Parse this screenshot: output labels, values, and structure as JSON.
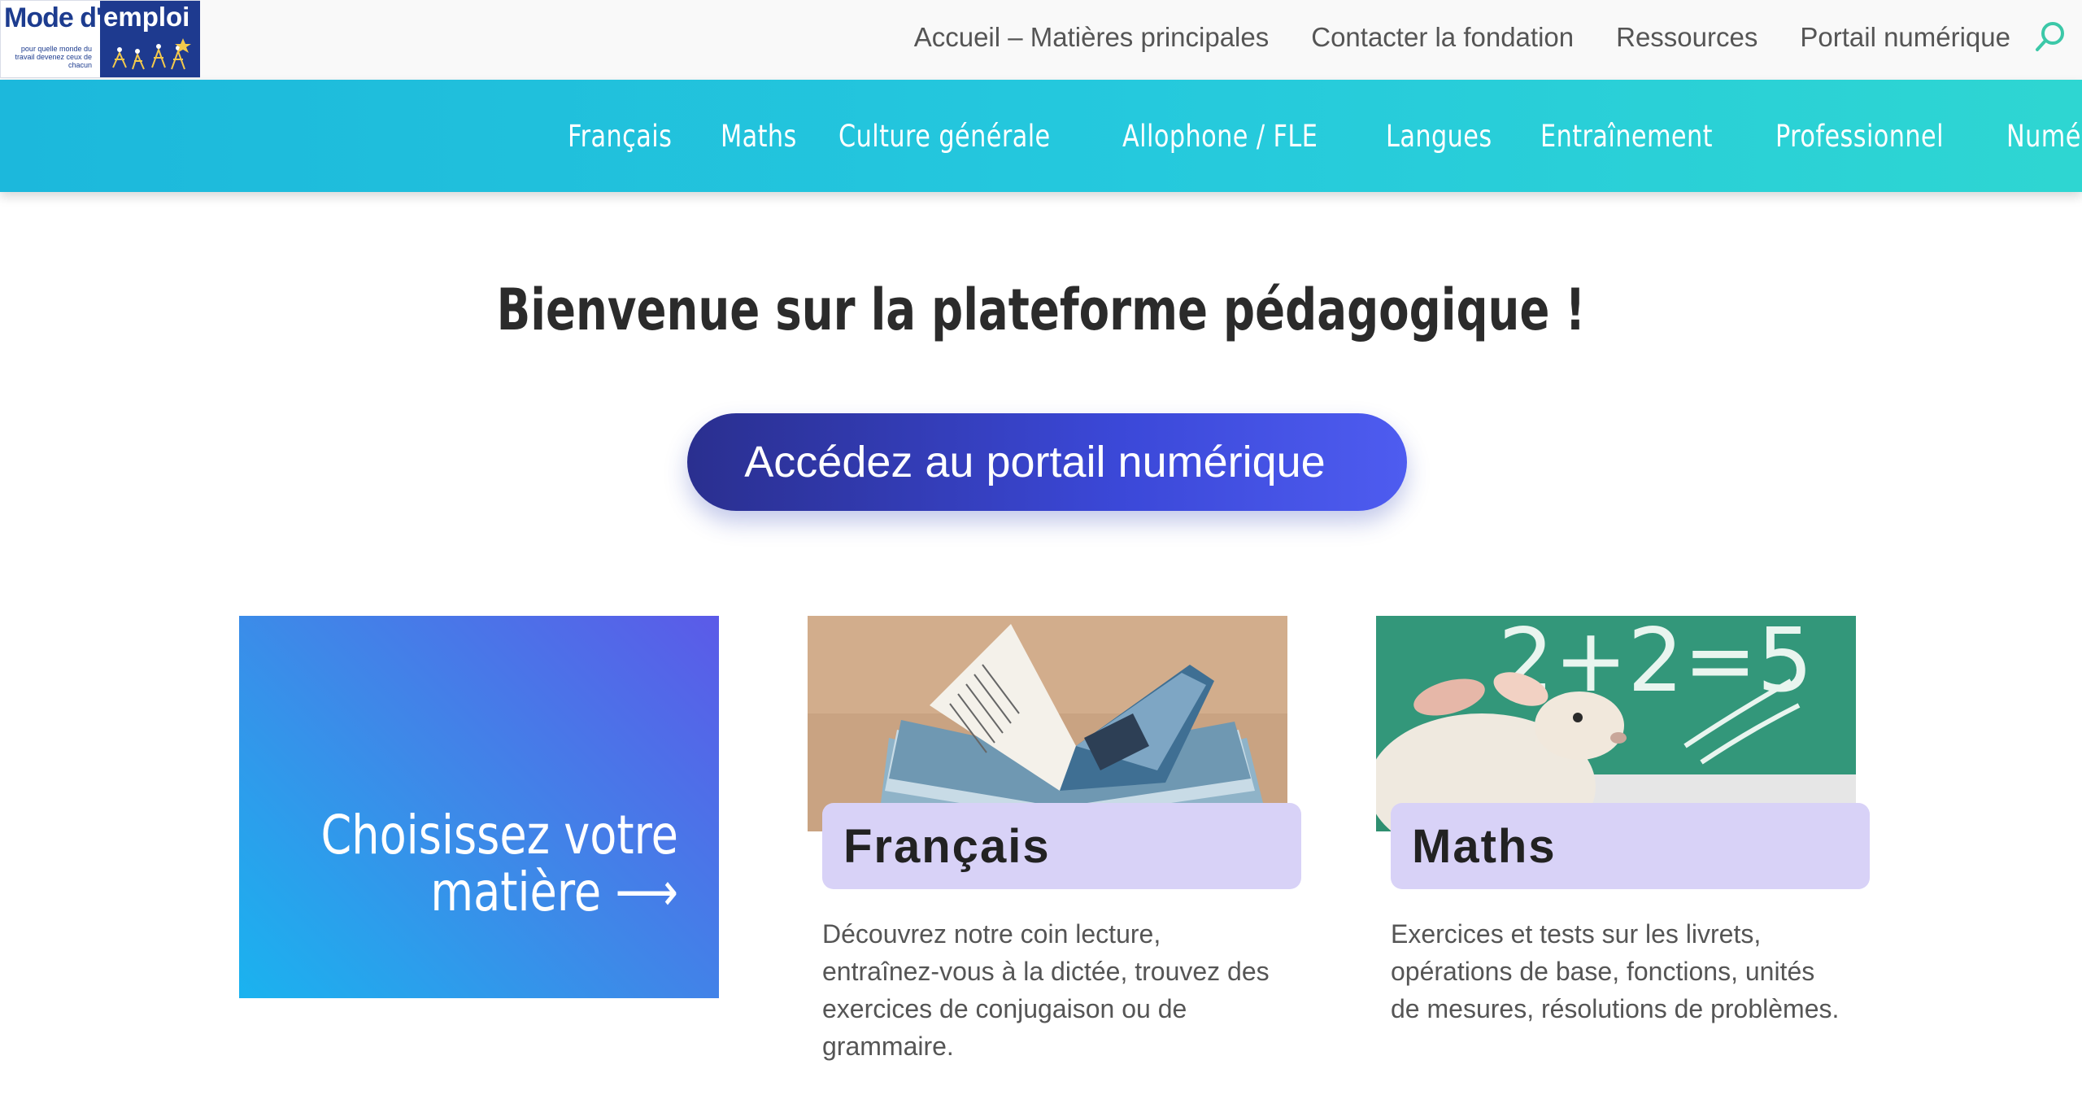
{
  "brand": {
    "logo_prefix": "Mode d'",
    "logo_word": "emploi",
    "tagline": "pour quelle monde du travail devenez ceux de chacun"
  },
  "top_nav": {
    "links": [
      "Accueil – Matières principales",
      "Contacter la fondation",
      "Ressources",
      "Portail numérique"
    ],
    "search_icon": "search-icon"
  },
  "main_nav": {
    "items": [
      "Français",
      "Maths",
      "Culture générale",
      "Allophone / FLE",
      "Langues",
      "Entraînement",
      "Professionnel",
      "Numérique"
    ],
    "colors": {
      "start": "#1cb8dc",
      "end": "#2ed6d2"
    }
  },
  "hero": {
    "welcome": "Bienvenue sur la plateforme pédagogique !",
    "cta_label": "Accédez au portail numérique"
  },
  "choose": {
    "line1": "Choisissez votre",
    "line2": "matière ⟶"
  },
  "cards": [
    {
      "title": "Français",
      "description": "Découvrez notre coin lecture, entraînez-vous à la dictée, trouvez des exercices de conjugaison ou de grammaire.",
      "image": "open-book"
    },
    {
      "title": "Maths",
      "description": "Exercices et tests sur les livrets, opérations de base, fonctions, unités de mesures, résolutions de problèmes.",
      "image": "sheep-chalkboard",
      "chalk_text": "2+2=5"
    }
  ]
}
